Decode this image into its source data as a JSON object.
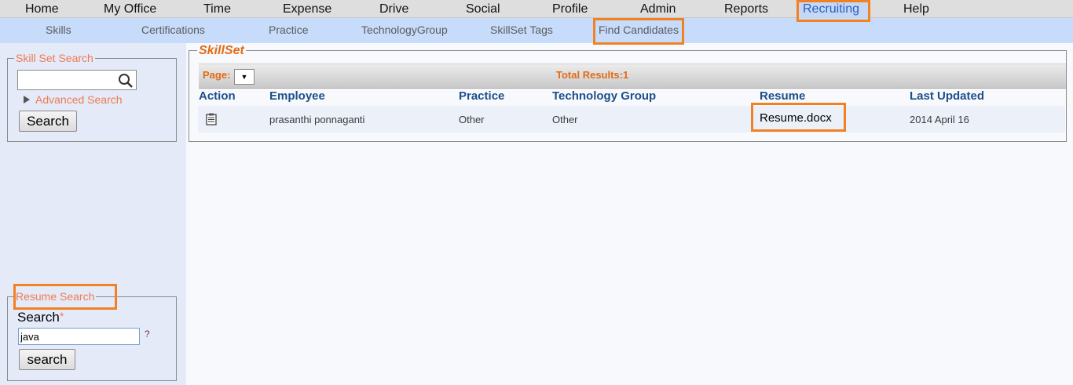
{
  "top_nav": {
    "home": "Home",
    "my_office": "My Office",
    "time": "Time",
    "expense": "Expense",
    "drive": "Drive",
    "social": "Social",
    "profile": "Profile",
    "admin": "Admin",
    "reports": "Reports",
    "recruiting": "Recruiting",
    "help": "Help"
  },
  "sub_nav": {
    "skills": "Skills",
    "certifications": "Certifications",
    "practice": "Practice",
    "technology_group": "TechnologyGroup",
    "skillset_tags": "SkillSet Tags",
    "find_candidates": "Find Candidates"
  },
  "skill_set_search": {
    "legend": "Skill Set Search",
    "input_value": "",
    "advanced_label": "Advanced Search",
    "search_button": "Search"
  },
  "resume_search": {
    "legend": "Resume Search",
    "label": "Search",
    "required_mark": "*",
    "input_value": "java",
    "help_mark": "?",
    "search_button": "search"
  },
  "results": {
    "legend": "SkillSet",
    "page_label": "Page:",
    "page_select_glyph": "▼",
    "total_results": "Total Results:1",
    "columns": {
      "action": "Action",
      "employee": "Employee",
      "practice": "Practice",
      "technology_group": "Technology Group",
      "resume": "Resume",
      "last_updated": "Last Updated"
    },
    "rows": [
      {
        "employee": "prasanthi ponnaganti",
        "practice": "Other",
        "technology_group": "Other",
        "resume": "Resume.docx",
        "last_updated": "2014 April 16"
      }
    ]
  },
  "colors": {
    "highlight": "#f28123",
    "accent_orange": "#e36b14",
    "header_blue": "#1d4f8a",
    "subnav_bg": "#c7dbfb"
  },
  "icons": {
    "search": "magnifier-icon",
    "action": "clipboard-icon",
    "advanced": "triangle-right-icon"
  }
}
